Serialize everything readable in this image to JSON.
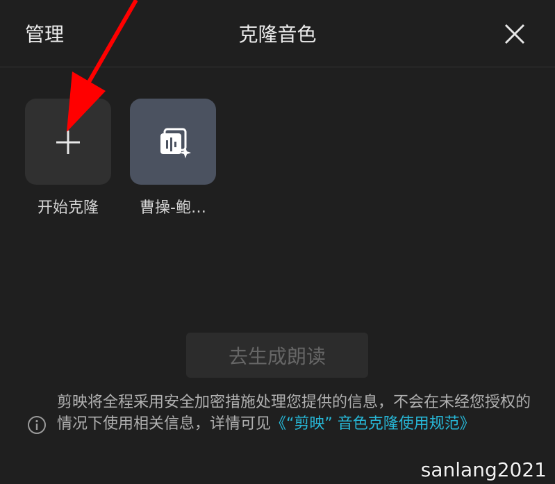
{
  "header": {
    "manage_label": "管理",
    "title": "克隆音色",
    "close_icon": "close-icon"
  },
  "tiles": [
    {
      "label": "开始克隆",
      "icon": "plus-icon"
    },
    {
      "label": "曹操-鲍…",
      "icon": "voice-clone-icon"
    }
  ],
  "generate_button_label": "去生成朗读",
  "notice": {
    "text": "剪映将全程采用安全加密措施处理您提供的信息，不会在未经您授权的情况下使用相关信息，详情可见",
    "link": "《“剪映” 音色克隆使用规范》",
    "icon": "info-icon"
  },
  "watermark": "sanlang2021",
  "colors": {
    "background": "#1f1f1f",
    "link": "#27b8d8",
    "annotation_arrow": "#ff0000"
  }
}
